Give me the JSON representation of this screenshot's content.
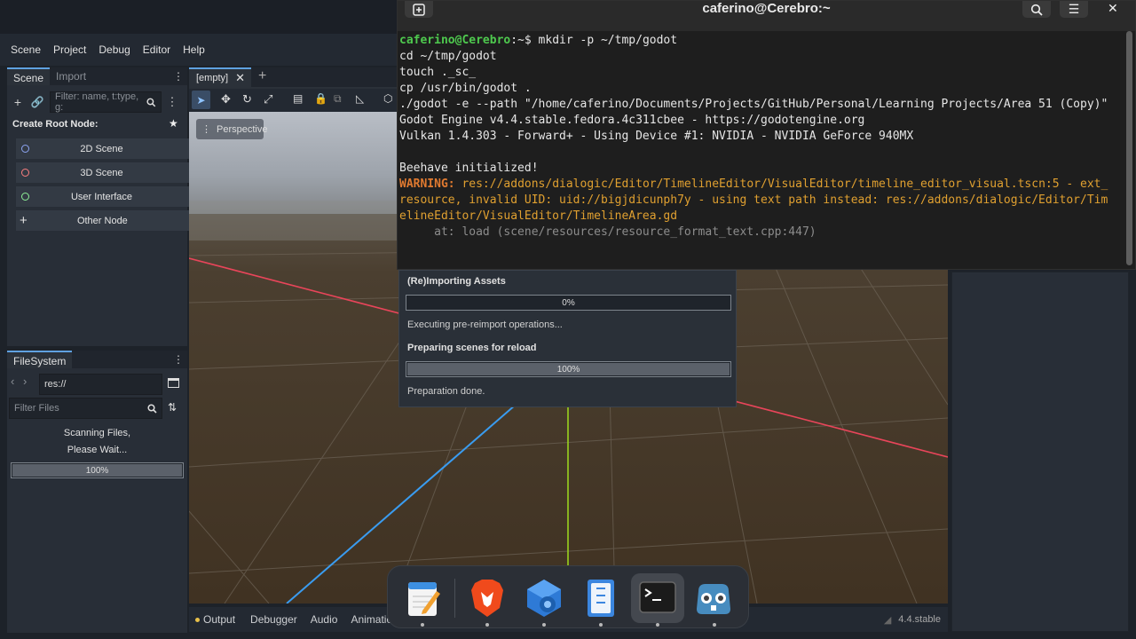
{
  "terminal": {
    "title": "caferino@Cerebro:~",
    "prompt_user": "caferino@Cerebro",
    "prompt_rest": ":~$ mkdir -p ~/tmp/godot",
    "lines": [
      "cd ~/tmp/godot",
      "touch ._sc_",
      "cp /usr/bin/godot .",
      "./godot -e --path \"/home/caferino/Documents/Projects/GitHub/Personal/Learning Projects/Area 51 (Copy)\"",
      "Godot Engine v4.4.stable.fedora.4c311cbee - https://godotengine.org",
      "Vulkan 1.4.303 - Forward+ - Using Device #1: NVIDIA - NVIDIA GeForce 940MX",
      "",
      "Beehave initialized!"
    ],
    "warning_label": "WARNING:",
    "warning_line1": " res://addons/dialogic/Editor/TimelineEditor/VisualEditor/timeline_editor_visual.tscn:5 - ext_",
    "warning_line2": "resource, invalid UID: uid://bigjdicunph7y - using text path instead: res://addons/dialogic/Editor/Tim",
    "warning_line3": "elineEditor/VisualEditor/TimelineArea.gd",
    "at_line": "     at: load (scene/resources/resource_format_text.cpp:447)"
  },
  "menu": [
    "Scene",
    "Project",
    "Debug",
    "Editor",
    "Help"
  ],
  "scene_dock": {
    "tabs": [
      "Scene",
      "Import"
    ],
    "filter_placeholder": "Filter: name, t:type, g:",
    "create_root": "Create Root Node:",
    "nodes": [
      "2D Scene",
      "3D Scene",
      "User Interface",
      "Other Node"
    ]
  },
  "filesystem": {
    "tab": "FileSystem",
    "path": "res://",
    "filter_placeholder": "Filter Files",
    "scanning_1": "Scanning Files,",
    "scanning_2": "Please Wait...",
    "progress_label": "100%",
    "progress": 1.0
  },
  "viewport": {
    "scene_tab": "[empty]",
    "perspective": "Perspective"
  },
  "import_dialog": {
    "title": "(Re)Importing Assets",
    "progress1_label": "0%",
    "progress1": 0.0,
    "status1": "Executing pre-reimport operations...",
    "step2": "Preparing scenes for reload",
    "progress2_label": "100%",
    "progress2": 1.0,
    "status2": "Preparation done."
  },
  "bottom_tabs": [
    "Output",
    "Debugger",
    "Audio",
    "Animation"
  ],
  "version": "4.4.stable",
  "dock_apps": [
    "text-editor-icon",
    "brave-browser-icon",
    "software-settings-icon",
    "file-archiver-icon",
    "terminal-icon",
    "godot-icon"
  ],
  "colors": {
    "x_axis": "#e8455a",
    "y_axis": "#9ad21e",
    "z_axis": "#3a9cf0",
    "accent": "#5fa1e0",
    "warning": "#e0a030"
  }
}
